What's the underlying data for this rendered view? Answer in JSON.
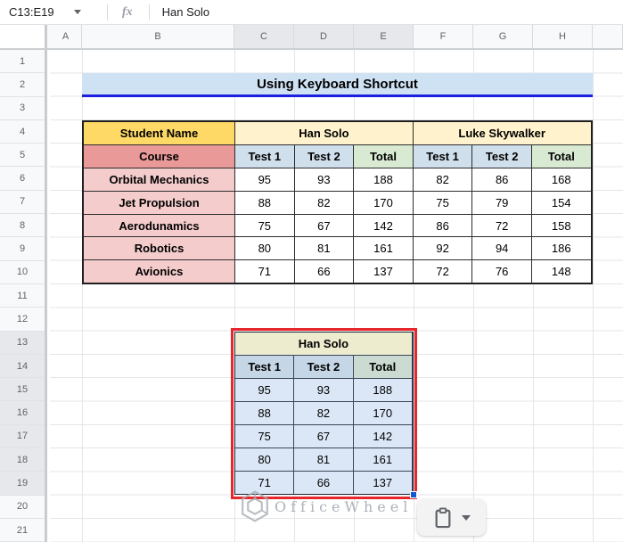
{
  "formula_bar": {
    "name_box": "C13:E19",
    "fx_label": "fx",
    "formula_value": "Han Solo"
  },
  "grid": {
    "column_headers": [
      "A",
      "B",
      "C",
      "D",
      "E",
      "F",
      "G",
      "H"
    ],
    "selected_columns": [
      "C",
      "D",
      "E"
    ],
    "row_headers": [
      "1",
      "2",
      "3",
      "4",
      "5",
      "6",
      "7",
      "8",
      "9",
      "10",
      "11",
      "12",
      "13",
      "14",
      "15",
      "16",
      "17",
      "18",
      "19",
      "20",
      "21"
    ],
    "selected_rows": [
      "13",
      "14",
      "15",
      "16",
      "17",
      "18",
      "19"
    ]
  },
  "title_banner": {
    "text": "Using Keyboard Shortcut"
  },
  "main_table": {
    "corner_header": "Student Name",
    "row_header_label": "Course",
    "group_headers": [
      "Han Solo",
      "Luke Skywalker"
    ],
    "sub_headers": [
      "Test 1",
      "Test 2",
      "Total",
      "Test 1",
      "Test 2",
      "Total"
    ],
    "rows": [
      {
        "course": "Orbital Mechanics",
        "values": [
          "95",
          "93",
          "188",
          "82",
          "86",
          "168"
        ]
      },
      {
        "course": "Jet Propulsion",
        "values": [
          "88",
          "82",
          "170",
          "75",
          "79",
          "154"
        ]
      },
      {
        "course": "Aerodunamics",
        "values": [
          "75",
          "67",
          "142",
          "86",
          "72",
          "158"
        ]
      },
      {
        "course": "Robotics",
        "values": [
          "80",
          "81",
          "161",
          "92",
          "94",
          "186"
        ]
      },
      {
        "course": "Avionics",
        "values": [
          "71",
          "66",
          "137",
          "72",
          "76",
          "148"
        ]
      }
    ]
  },
  "copied_table": {
    "title": "Han Solo",
    "sub_headers": [
      "Test 1",
      "Test 2",
      "Total"
    ],
    "rows": [
      [
        "95",
        "93",
        "188"
      ],
      [
        "88",
        "82",
        "170"
      ],
      [
        "75",
        "67",
        "142"
      ],
      [
        "80",
        "81",
        "161"
      ],
      [
        "71",
        "66",
        "137"
      ]
    ]
  },
  "watermark": {
    "text": "OfficeWheel"
  },
  "paste_button": {
    "icon": "clipboard-icon",
    "dropdown_icon": "chevron-down-icon"
  },
  "colors": {
    "title_bg": "#cfe2f3",
    "title_border": "#1b1fe0",
    "student_name_bg": "#ffd966",
    "group_header_bg": "#fff2cc",
    "course_label_bg": "#ea9999",
    "course_cell_bg": "#f4cccc",
    "test_header_bg": "#cfdfec",
    "total_header_bg": "#d9ead3",
    "selection_tint_bg": "#dbe7f6",
    "annotation_red": "#e8272c",
    "fill_handle_blue": "#1259cf",
    "header_selected_bg": "#e6e8eb"
  }
}
